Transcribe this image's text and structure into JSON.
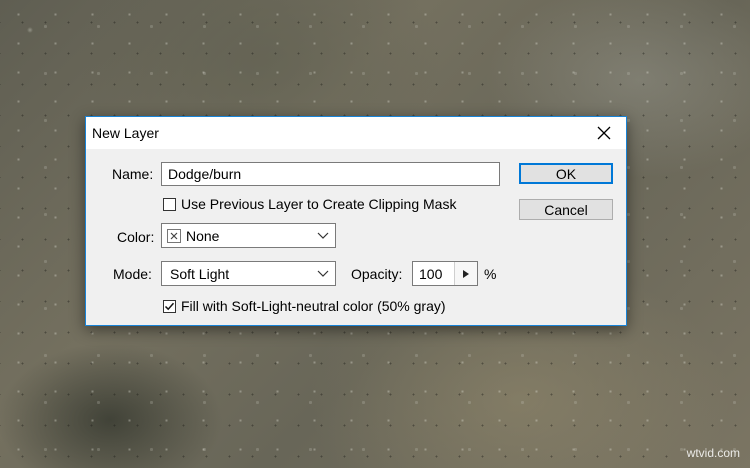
{
  "dialog": {
    "title": "New Layer",
    "name_label": "Name:",
    "name_value": "Dodge/burn",
    "clipping_label": "Use Previous Layer to Create Clipping Mask",
    "clipping_checked": false,
    "color_label": "Color:",
    "color_value": "None",
    "mode_label": "Mode:",
    "mode_value": "Soft Light",
    "opacity_label": "Opacity:",
    "opacity_value": "100",
    "opacity_unit": "%",
    "fill_label": "Fill with Soft-Light-neutral color (50% gray)",
    "fill_checked": true,
    "ok_label": "OK",
    "cancel_label": "Cancel"
  },
  "icons": {
    "close": "close-icon",
    "chevron": "chevron-down-icon",
    "color_swatch": "none-swatch-icon",
    "check": "check-icon",
    "stepper": "triangle-right-icon"
  },
  "colors": {
    "accent": "#0078d7",
    "window_border": "#1883d7",
    "dialog_bg": "#f0f0f0"
  },
  "watermark": "wtvid.com"
}
